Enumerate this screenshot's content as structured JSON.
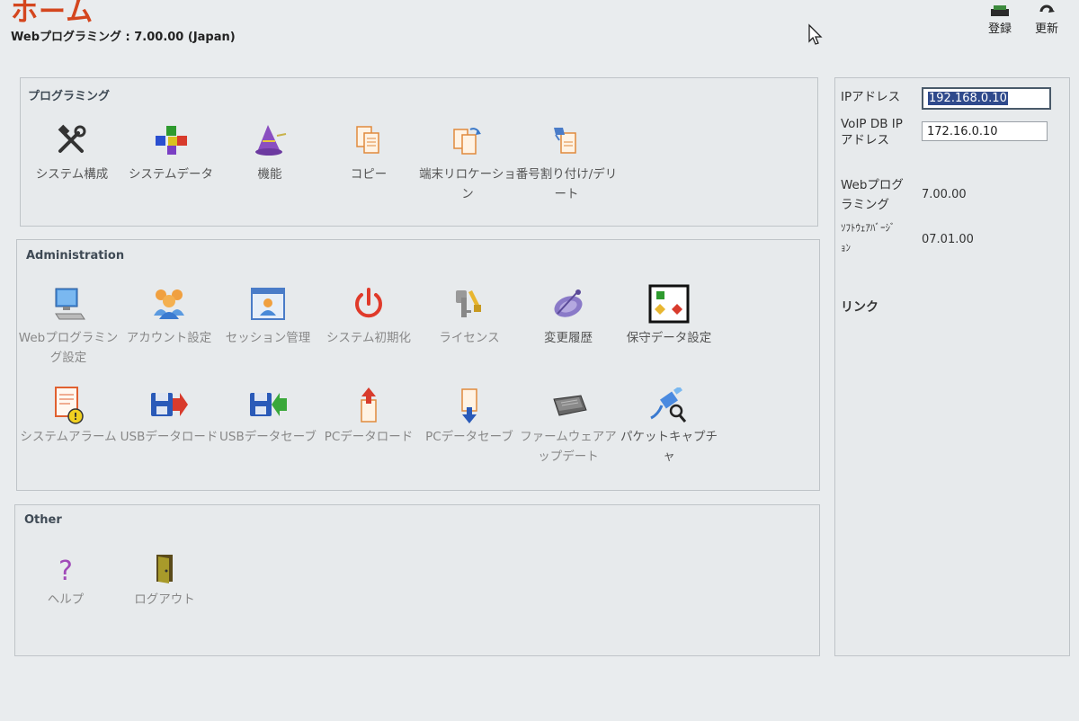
{
  "header": {
    "title": "ホーム",
    "subtitle": "Webプログラミング : 7.00.00 (Japan)",
    "register_label": "登録",
    "refresh_label": "更新"
  },
  "sections": {
    "programming": {
      "title": "プログラミング",
      "items": [
        {
          "label": "システム構成",
          "icon": "tools-icon"
        },
        {
          "label": "システムデータ",
          "icon": "cubes-icon"
        },
        {
          "label": "機能",
          "icon": "wizard-hat-icon"
        },
        {
          "label": "コピー",
          "icon": "copy-icon"
        },
        {
          "label": "端末リロケーション",
          "icon": "relocation-icon"
        },
        {
          "label": "番号割り付け/デリート",
          "icon": "number-assign-icon"
        }
      ]
    },
    "administration": {
      "title": "Administration",
      "items": [
        {
          "label": "Webプログラミング設定",
          "icon": "computer-icon"
        },
        {
          "label": "アカウント設定",
          "icon": "users-icon"
        },
        {
          "label": "セッション管理",
          "icon": "session-icon"
        },
        {
          "label": "システム初期化",
          "icon": "power-icon"
        },
        {
          "label": "ライセンス",
          "icon": "key-icon"
        },
        {
          "label": "変更履歴",
          "icon": "history-icon"
        },
        {
          "label": "保守データ設定",
          "icon": "maintenance-icon"
        },
        {
          "label": "システムアラーム",
          "icon": "alarm-icon"
        },
        {
          "label": "USBデータロード",
          "icon": "usb-load-icon"
        },
        {
          "label": "USBデータセーブ",
          "icon": "usb-save-icon"
        },
        {
          "label": "PCデータロード",
          "icon": "pc-load-icon"
        },
        {
          "label": "PCデータセーブ",
          "icon": "pc-save-icon"
        },
        {
          "label": "ファームウェアアップデート",
          "icon": "firmware-icon"
        },
        {
          "label": "パケットキャプチャ",
          "icon": "packet-capture-icon"
        }
      ]
    },
    "other": {
      "title": "Other",
      "items": [
        {
          "label": "ヘルプ",
          "icon": "help-icon"
        },
        {
          "label": "ログアウト",
          "icon": "logout-door-icon"
        }
      ]
    }
  },
  "side": {
    "ip_label": "IPアドレス",
    "ip_value": "192.168.0.10",
    "voip_label_1": "VoIP DB IP",
    "voip_label_2": "アドレス",
    "voip_value": "172.16.0.10",
    "webprog_label_1": "Webプログ",
    "webprog_label_2": "ラミング",
    "webprog_value": "7.00.00",
    "software_label_1": "ｿﾌﾄｳｪｱﾊﾞｰｼﾞ",
    "software_label_2": "ｮﾝ",
    "software_value": "07.01.00",
    "links_title": "リンク"
  }
}
